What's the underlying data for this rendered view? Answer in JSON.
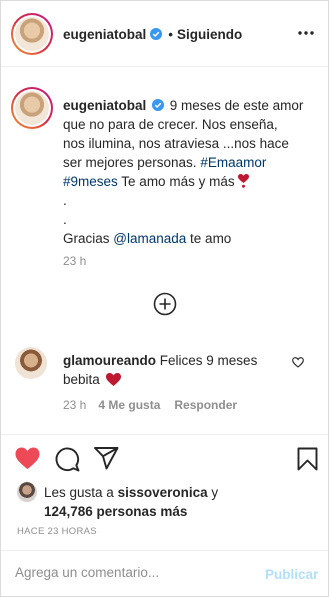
{
  "header": {
    "username": "eugeniatobal",
    "separator": "•",
    "following_label": "Siguiendo",
    "more_icon": "more-horizontal-icon"
  },
  "post": {
    "caption_username": "eugeniatobal",
    "caption_lines": [
      "9 meses de este amor",
      "que no para de crecer. Nos enseña,",
      "nos ilumina, nos atraviesa ...nos hace",
      "ser mejores personas."
    ],
    "hashtag1": "#Emaamor",
    "hashtag2": "#9meses",
    "love_text": "Te amo más y más",
    "dot1": ".",
    "dot2": ".",
    "gracias": "Gracias",
    "mention": "@lamanada",
    "te_amo": "te amo",
    "time": "23 h",
    "load_more_icon": "plus-circle-icon"
  },
  "comment": {
    "username": "glamoureando",
    "text_line1": "Felices 9 meses",
    "text_line2": "bebita",
    "time": "23 h",
    "likes": "4 Me gusta",
    "reply": "Responder"
  },
  "actions": {
    "liked": true,
    "like_color": "#ed4956"
  },
  "likes": {
    "prefix": "Les gusta a",
    "user": "sissoveronica",
    "conjunction": "y",
    "count": "124,786 personas más"
  },
  "timestamp": "HACE 23 HORAS",
  "comment_box": {
    "placeholder": "Agrega un comentario...",
    "publish": "Publicar"
  },
  "colors": {
    "link": "#00376b",
    "muted": "#8e8e8e",
    "publish_disabled": "#b2dffc",
    "verified": "#3897f0"
  }
}
